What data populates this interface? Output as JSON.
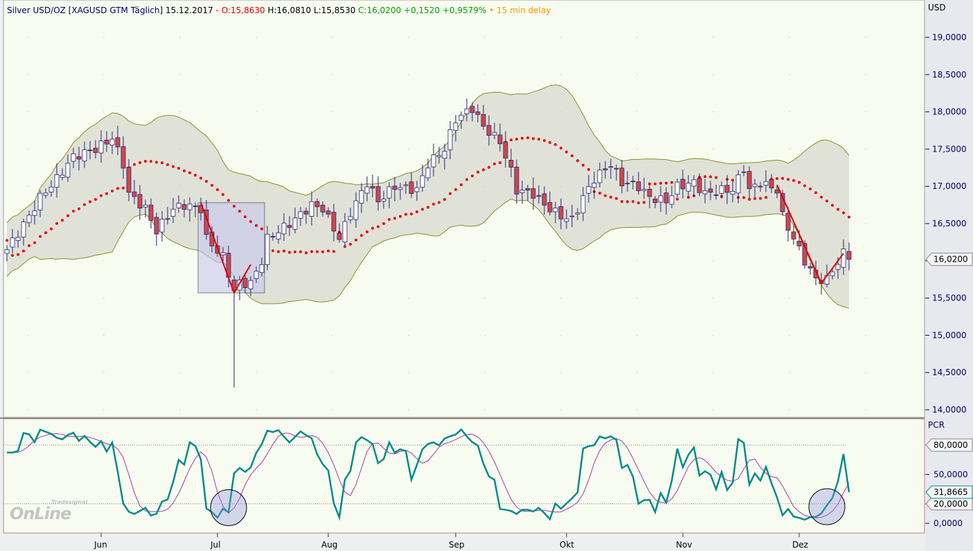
{
  "header": {
    "title": "Silver USD/OZ [XAGUSD GTM Täglich]",
    "date": "15.12.2017",
    "dash": "-",
    "open": "O:15,8630",
    "high": "H:16,0810",
    "low": "L:15,8530",
    "close": "C:16,0200",
    "change": "+0,1520",
    "change_pct": "+0,9579%",
    "bullet": "•",
    "delay": "15 min delay"
  },
  "colors": {
    "title": "#000066",
    "open": "#e00000",
    "close": "#00a000",
    "delay": "#ff9900",
    "band_line": "#8c8c1c",
    "band_fill": "#dcddd4",
    "sar": "#ee0000",
    "stoch_k": "#008a8a",
    "stoch_d": "#a03ca0",
    "bg": "#f8fbf0"
  },
  "logo": {
    "small": "Tradesignal",
    "big": "OnLine"
  },
  "chart_data": [
    {
      "type": "candlestick",
      "title": "Silver USD/OZ",
      "ylabel": "USD",
      "ylim": [
        14,
        19
      ],
      "yticks": [
        "19,0000",
        "18,5000",
        "18,0000",
        "17,5000",
        "17,0000",
        "16,5000",
        "16,0000",
        "15,5000",
        "15,0000",
        "14,5000",
        "14,0000"
      ],
      "ytick_values": [
        19,
        18.5,
        18,
        17.5,
        17,
        16.5,
        16,
        15.5,
        15,
        14.5,
        14
      ],
      "last_price": 16.02,
      "last_label": "16,0200",
      "close_keypoints": [
        [
          0,
          16.15
        ],
        [
          4,
          16.6
        ],
        [
          6,
          16.85
        ],
        [
          9,
          17.1
        ],
        [
          12,
          17.4
        ],
        [
          16,
          17.5
        ],
        [
          19,
          17.65
        ],
        [
          21,
          17.3
        ],
        [
          22,
          16.9
        ],
        [
          25,
          16.7
        ],
        [
          27,
          16.4
        ],
        [
          30,
          16.7
        ],
        [
          32,
          16.75
        ],
        [
          35,
          16.7
        ],
        [
          36,
          16.3
        ],
        [
          39,
          16.05
        ],
        [
          41,
          15.6
        ],
        [
          42,
          15.7
        ],
        [
          44,
          15.7
        ],
        [
          46,
          16.0
        ],
        [
          47,
          16.3
        ],
        [
          51,
          16.5
        ],
        [
          55,
          16.75
        ],
        [
          57,
          16.7
        ],
        [
          60,
          16.3
        ],
        [
          62,
          16.65
        ],
        [
          65,
          17.05
        ],
        [
          67,
          16.8
        ],
        [
          70,
          17.0
        ],
        [
          74,
          16.95
        ],
        [
          76,
          17.3
        ],
        [
          79,
          17.5
        ],
        [
          81,
          17.9
        ],
        [
          84,
          18.05
        ],
        [
          86,
          17.8
        ],
        [
          89,
          17.6
        ],
        [
          91,
          17.2
        ],
        [
          92,
          16.95
        ],
        [
          95,
          16.9
        ],
        [
          97,
          16.75
        ],
        [
          100,
          16.6
        ],
        [
          102,
          16.55
        ],
        [
          104,
          16.85
        ],
        [
          106,
          17.1
        ],
        [
          109,
          17.3
        ],
        [
          111,
          17.05
        ],
        [
          114,
          17.0
        ],
        [
          116,
          16.85
        ],
        [
          119,
          16.8
        ],
        [
          121,
          17.0
        ],
        [
          124,
          17.05
        ],
        [
          126,
          16.9
        ],
        [
          129,
          16.95
        ],
        [
          131,
          16.95
        ],
        [
          133,
          17.25
        ],
        [
          134,
          16.95
        ],
        [
          136,
          17.05
        ],
        [
          139,
          16.95
        ],
        [
          140,
          16.6
        ],
        [
          142,
          16.3
        ],
        [
          144,
          16.0
        ],
        [
          146,
          15.75
        ],
        [
          148,
          15.75
        ],
        [
          151,
          16.1
        ],
        [
          152,
          16.02
        ]
      ],
      "spike_low": {
        "day": 41,
        "low": 14.3
      },
      "annotation_box": {
        "day_from": 35,
        "day_to": 46,
        "price_from": 15.57,
        "price_to": 16.78
      },
      "trend_lines": [
        [
          [
            35,
            16.78
          ],
          [
            41,
            15.57
          ],
          [
            44,
            15.95
          ]
        ],
        [
          [
            139,
            17.02
          ],
          [
            147,
            15.7
          ],
          [
            151,
            16.1
          ]
        ]
      ],
      "x_ticks": [
        {
          "label": "Jun",
          "day": 17
        },
        {
          "label": "Jul",
          "day": 38
        },
        {
          "label": "Aug",
          "day": 58
        },
        {
          "label": "Sep",
          "day": 81
        },
        {
          "label": "Okt",
          "day": 101
        },
        {
          "label": "Nov",
          "day": 122
        },
        {
          "label": "Dez",
          "day": 143
        }
      ]
    },
    {
      "type": "line",
      "title": "PCR",
      "ylim": [
        -10,
        105
      ],
      "yticks": [
        "80,0000",
        "50,0000",
        "20,0000",
        "0,0000"
      ],
      "ytick_values": [
        80,
        50,
        20,
        0
      ],
      "levels": [
        80,
        20
      ],
      "last_value": 31.8665,
      "last_label": "31,8665",
      "circles": [
        {
          "day": 40,
          "value": 16
        },
        {
          "day": 148,
          "value": 17
        }
      ]
    }
  ]
}
